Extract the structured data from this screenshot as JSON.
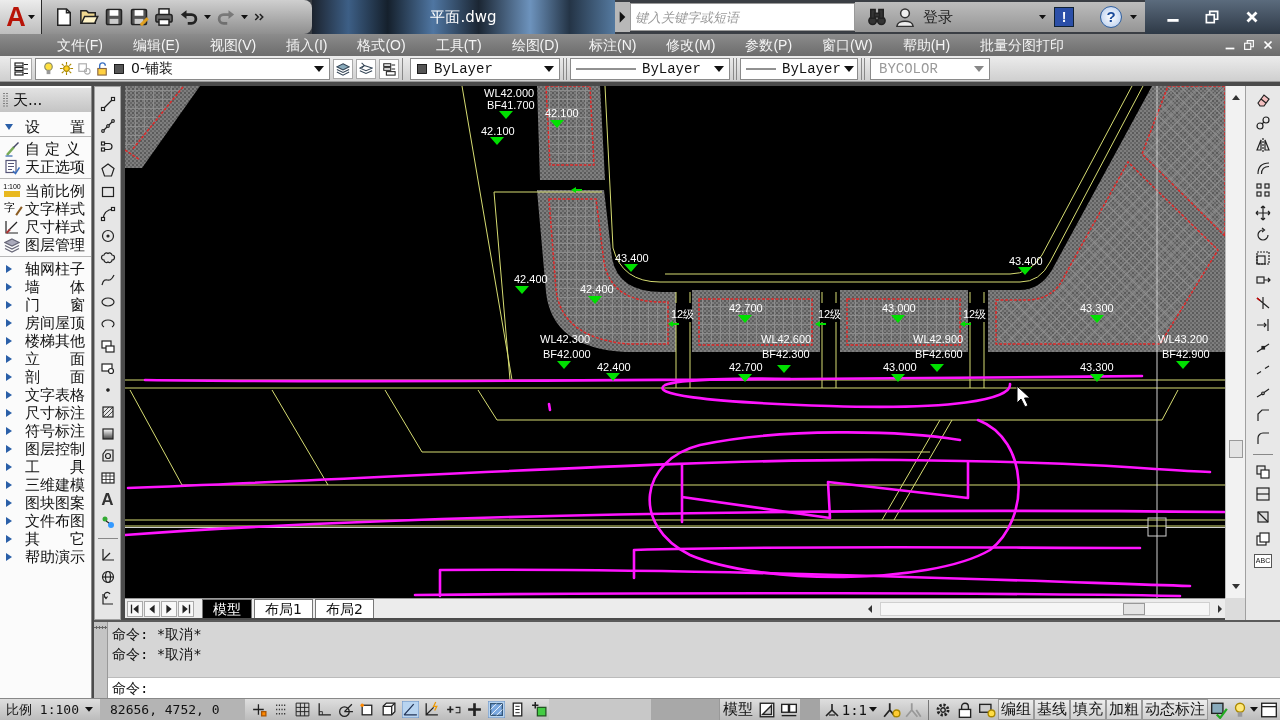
{
  "title_bar": {
    "logo": "A",
    "quick_access": {
      "undo_disabled": false,
      "redo_disabled": true
    },
    "title": "平面.dwg",
    "search": {
      "placeholder": "键入关键字或短语"
    },
    "sign_in": "登录",
    "alert_glyph": "!",
    "help_glyph": "?"
  },
  "menu_bar": [
    "文件(F)",
    "编辑(E)",
    "视图(V)",
    "插入(I)",
    "格式(O)",
    "工具(T)",
    "绘图(D)",
    "标注(N)",
    "修改(M)",
    "参数(P)",
    "窗口(W)",
    "帮助(H)",
    "批量分图打印"
  ],
  "layer_toolbar": {
    "layer": "0-铺装",
    "dropdowns": [
      {
        "kind": "color",
        "value": "ByLayer",
        "disabled": false
      },
      {
        "kind": "linetype",
        "value": "ByLayer",
        "disabled": false
      },
      {
        "kind": "lineweight",
        "value": "ByLayer",
        "disabled": false
      },
      {
        "kind": "plot_style",
        "value": "BYCOLOR",
        "disabled": true
      }
    ]
  },
  "tianzheng_panel": {
    "title": "天...",
    "items": [
      {
        "label": "设 置",
        "expanded": true,
        "children": [
          {
            "label": "自 定 义"
          },
          {
            "label": "天正选项"
          },
          {
            "label": "当前比例",
            "icon_text": "1:100"
          },
          {
            "label": "文字样式",
            "icon_text": "字"
          },
          {
            "label": "尺寸样式"
          },
          {
            "label": "图层管理"
          }
        ]
      },
      {
        "label": "轴网柱子",
        "expanded": false
      },
      {
        "label": "墙 体",
        "expanded": false
      },
      {
        "label": "门 窗",
        "expanded": false
      },
      {
        "label": "房间屋顶",
        "expanded": false
      },
      {
        "label": "楼梯其他",
        "expanded": false
      },
      {
        "label": "立 面",
        "expanded": false
      },
      {
        "label": "剖 面",
        "expanded": false
      },
      {
        "label": "文字表格",
        "expanded": false
      },
      {
        "label": "尺寸标注",
        "expanded": false
      },
      {
        "label": "符号标注",
        "expanded": false
      },
      {
        "label": "图层控制",
        "expanded": false
      },
      {
        "label": "工 具",
        "expanded": false
      },
      {
        "label": "三维建模",
        "expanded": false
      },
      {
        "label": "图块图案",
        "expanded": false
      },
      {
        "label": "文件布图",
        "expanded": false
      },
      {
        "label": "其 它",
        "expanded": false
      },
      {
        "label": "帮助演示",
        "expanded": false
      }
    ]
  },
  "draw_toolbar": {
    "text_tool": "A"
  },
  "drawing": {
    "labels": [
      "WL42.000",
      "BF41.700",
      "42.100",
      "42.100",
      "43.400",
      "43.400",
      "42.400",
      "42.400",
      "42.700",
      "43.000",
      "43.300",
      "WL42.300",
      "WL42.600",
      "WL42.900",
      "WL43.200",
      "BF42.000",
      "BF42.300",
      "BF42.600",
      "BF42.900",
      "42.400",
      "42.700",
      "43.000",
      "43.300"
    ],
    "step_labels": [
      "12级",
      "12级",
      "12级"
    ]
  },
  "canvas_tabs": [
    {
      "label": "模型",
      "selected": true
    },
    {
      "label": "布局1",
      "selected": false
    },
    {
      "label": "布局2",
      "selected": false
    }
  ],
  "modify_toolbar": {
    "spelling_text": "ABC"
  },
  "command_line": {
    "history": [
      "命令: *取消*",
      "命令: *取消*"
    ],
    "prompt": "命令:"
  },
  "status_bar": {
    "scale": "比例 1:100",
    "coordinates": "82656, 4752, 0",
    "toggles": [
      {
        "on": false
      },
      {
        "on": false
      },
      {
        "on": false
      },
      {
        "on": false
      },
      {
        "on": false
      },
      {
        "on": false
      },
      {
        "on": false
      },
      {
        "on": true
      },
      {
        "on": false
      },
      {
        "on": false
      },
      {
        "on": false
      },
      {
        "on": true
      },
      {
        "on": false
      },
      {
        "on": false
      }
    ],
    "space": "模型",
    "annotation_scale": "1:1",
    "buttons": [
      "编组",
      "基线",
      "填充",
      "加粗",
      "动态标注"
    ]
  }
}
